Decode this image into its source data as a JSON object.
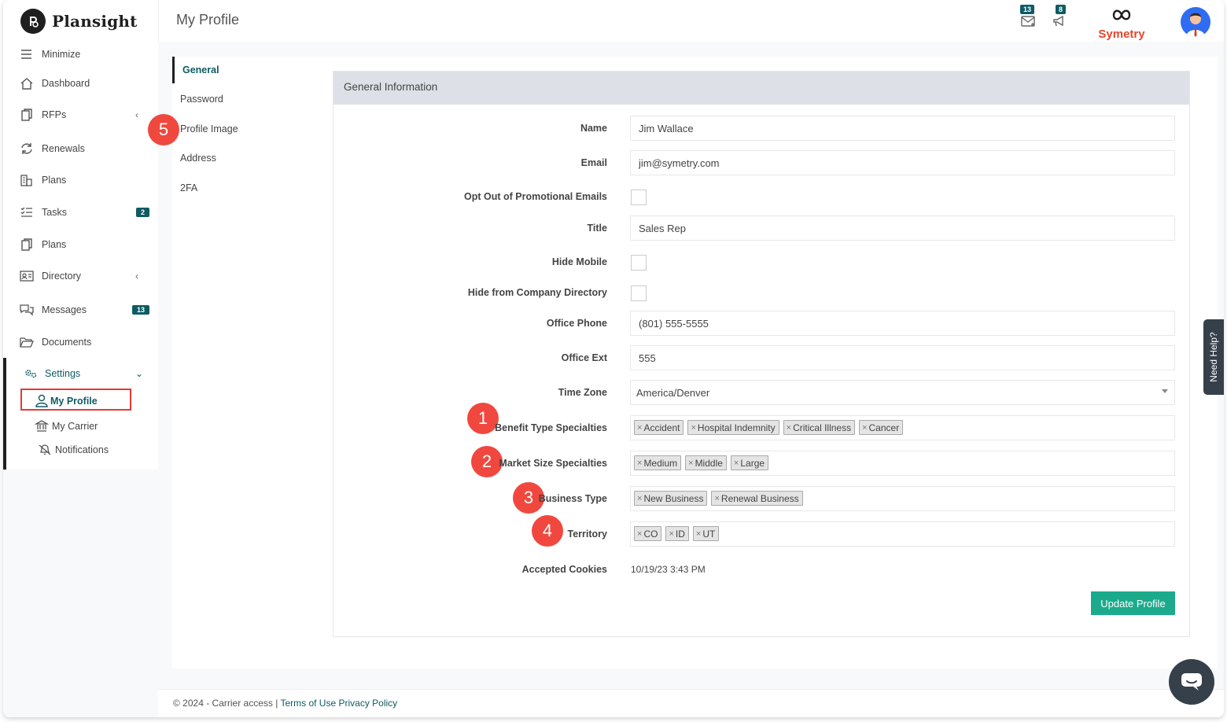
{
  "app": {
    "brand": "Plansight",
    "page_title": "My Profile"
  },
  "topbar": {
    "mail_count": "13",
    "announce_count": "8",
    "partner_logo_text": "Symetry"
  },
  "sidebar": {
    "items": [
      {
        "label": "Minimize"
      },
      {
        "label": "Dashboard"
      },
      {
        "label": "RFPs"
      },
      {
        "label": "Renewals"
      },
      {
        "label": "Plans"
      },
      {
        "label": "Tasks",
        "badge": "2"
      },
      {
        "label": "Plans"
      },
      {
        "label": "Directory"
      },
      {
        "label": "Messages",
        "badge": "13"
      },
      {
        "label": "Documents"
      },
      {
        "label": "Settings"
      }
    ],
    "settings_sub": [
      {
        "label": "My Profile"
      },
      {
        "label": "My Carrier"
      },
      {
        "label": "Notifications"
      }
    ]
  },
  "subnav": {
    "items": [
      "General",
      "Password",
      "Profile Image",
      "Address",
      "2FA"
    ]
  },
  "form": {
    "section_title": "General Information",
    "name_label": "Name",
    "name_value": "Jim Wallace",
    "email_label": "Email",
    "email_value": "jim@symetry.com",
    "optout_label": "Opt Out of Promotional Emails",
    "title_label": "Title",
    "title_value": "Sales Rep",
    "hide_mobile_label": "Hide Mobile",
    "hide_dir_label": "Hide from Company Directory",
    "phone_label": "Office Phone",
    "phone_value": "(801) 555-5555",
    "ext_label": "Office Ext",
    "ext_value": "555",
    "tz_label": "Time Zone",
    "tz_value": "America/Denver",
    "benefit_label": "Benefit Type Specialties",
    "benefit_tags": [
      "Accident",
      "Hospital Indemnity",
      "Critical Illness",
      "Cancer"
    ],
    "market_label": "Market Size Specialties",
    "market_tags": [
      "Medium",
      "Middle",
      "Large"
    ],
    "business_label": "Business Type",
    "business_tags": [
      "New Business",
      "Renewal Business"
    ],
    "territory_label": "Territory",
    "territory_tags": [
      "CO",
      "ID",
      "UT"
    ],
    "cookies_label": "Accepted Cookies",
    "cookies_value": "10/19/23 3:43 PM",
    "update_button": "Update Profile"
  },
  "callouts": [
    "1",
    "2",
    "3",
    "4",
    "5"
  ],
  "need_help": "Need Help?",
  "footer": {
    "copyright": "© 2024 - Carrier access |",
    "terms": "Terms of Use",
    "privacy": "Privacy Policy"
  },
  "colors": {
    "accent": "#0e5b63",
    "button": "#1bab8c",
    "callout": "#f0483e",
    "highlight_box": "#e53935"
  }
}
